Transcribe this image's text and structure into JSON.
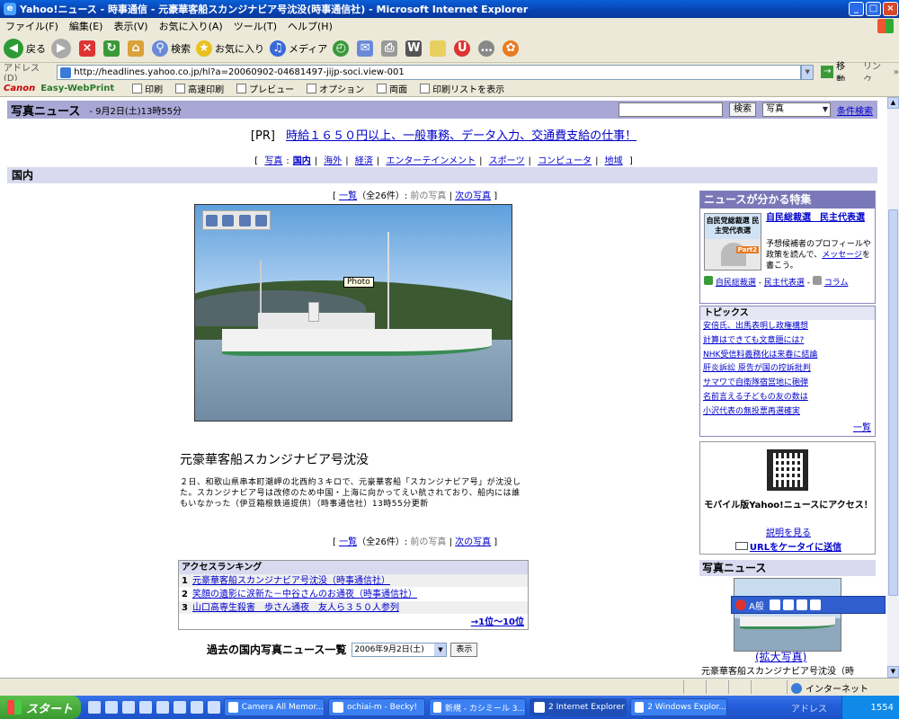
{
  "window": {
    "title": "Yahoo!ニュース - 時事通信 - 元豪華客船スカンジナビア号沈没(時事通信社) - Microsoft Internet Explorer"
  },
  "menu": [
    "ファイル(F)",
    "編集(E)",
    "表示(V)",
    "お気に入り(A)",
    "ツール(T)",
    "ヘルプ(H)"
  ],
  "toolbar": {
    "back": "戻る",
    "search": "検索",
    "favorites": "お気に入り",
    "media": "メディア"
  },
  "address": {
    "label": "アドレス(D)",
    "url": "http://headlines.yahoo.co.jp/hl?a=20060902-04681497-jijp-soci.view-001",
    "go": "移動",
    "links": "リンク"
  },
  "canon_bar": {
    "brand": "Canon",
    "product": "Easy-WebPrint",
    "items": [
      "印刷",
      "高速印刷",
      "プレビュー",
      "オプション",
      "両面",
      "印刷リストを表示"
    ]
  },
  "header": {
    "title": "写真ニュース",
    "datetime": "- 9月2日(土)13時55分",
    "search_button": "検索",
    "search_scope": "写真",
    "advanced": "条件検索"
  },
  "pr": {
    "tag": "[PR]",
    "text": "時給１６５０円以上、一般事務、データ入力、交通費支給の仕事！"
  },
  "category_nav": {
    "open": "[",
    "close": "]",
    "label": "写真",
    "current": "国内",
    "items": [
      "海外",
      "経済",
      "エンターテインメント",
      "スポーツ",
      "コンピュータ",
      "地域"
    ]
  },
  "section": "国内",
  "pager": {
    "list": "一覧",
    "count": "（全26件）",
    "prev": "前の写真",
    "next": "次の写真"
  },
  "photo": {
    "tooltip": "Photo"
  },
  "article": {
    "headline": "元豪華客船スカンジナビア号沈没",
    "body": "２日、和歌山県串本町潮岬の北西約３キロで、元豪華客船「スカンジナビア号」が沈没した。スカンジナビア号は改修のため中国・上海に向かってえい航されており、船内には誰もいなかった（伊豆箱根鉄道提供）（時事通信社）13時55分更新"
  },
  "ranking": {
    "title": "アクセスランキング",
    "items": [
      "元豪華客船スカンジナビア号沈没（時事通信社）",
      "笑顔の遺影に涙新た－中谷さんのお通夜（時事通信社）",
      "山口高専生殺害　歩さん通夜　友人ら３５０人参列"
    ],
    "more": "→1位〜10位"
  },
  "archive": {
    "label": "過去の国内写真ニュース一覧",
    "selected": "2006年9月2日(土)",
    "button": "表示"
  },
  "feature": {
    "header": "ニュースが分かる特集",
    "thumb_text": "自民党総裁選 民主党代表選",
    "thumb_badge": "Part2",
    "title": "自民総裁選　民主代表選",
    "desc_prefix": "予想候補者のプロフィールや政策を読んで、",
    "desc_link": "メッセージ",
    "desc_suffix": "を書こう。",
    "link1": "自民総裁選",
    "link2": "民主代表選",
    "link3": "コラム"
  },
  "topics": {
    "header": "トピックス",
    "items": [
      "安倍氏、出馬表明し政権構想",
      "計算はできても文章題には?",
      "NHK受信料義務化は来春に結論",
      "肝炎訴訟 原告が国の控訴批判",
      "サマワで自衛隊宿営地に砲弾",
      "名前言える子どもの友の数は",
      "小沢代表の無投票再選確実"
    ],
    "more": "一覧"
  },
  "mobile": {
    "text": "モバイル版Yahoo!ニュースにアクセス！",
    "explain": "説明を見る",
    "send": "URLをケータイに送信"
  },
  "photo_news": {
    "header": "写真ニュース",
    "enlarge": "(拡大写真)",
    "caption": "元豪華客船スカンジナビア号沈没（時"
  },
  "ime": {
    "mode": "A般"
  },
  "statusbar": {
    "zone": "インターネット"
  },
  "taskbar": {
    "start": "スタート",
    "buttons": [
      "Camera All Memor...",
      "ochiai-m - Becky!",
      "新規 - カシミール 3...",
      "2 Internet Explorer",
      "2 Windows Explor..."
    ],
    "address": "アドレス",
    "clock": "1554"
  }
}
